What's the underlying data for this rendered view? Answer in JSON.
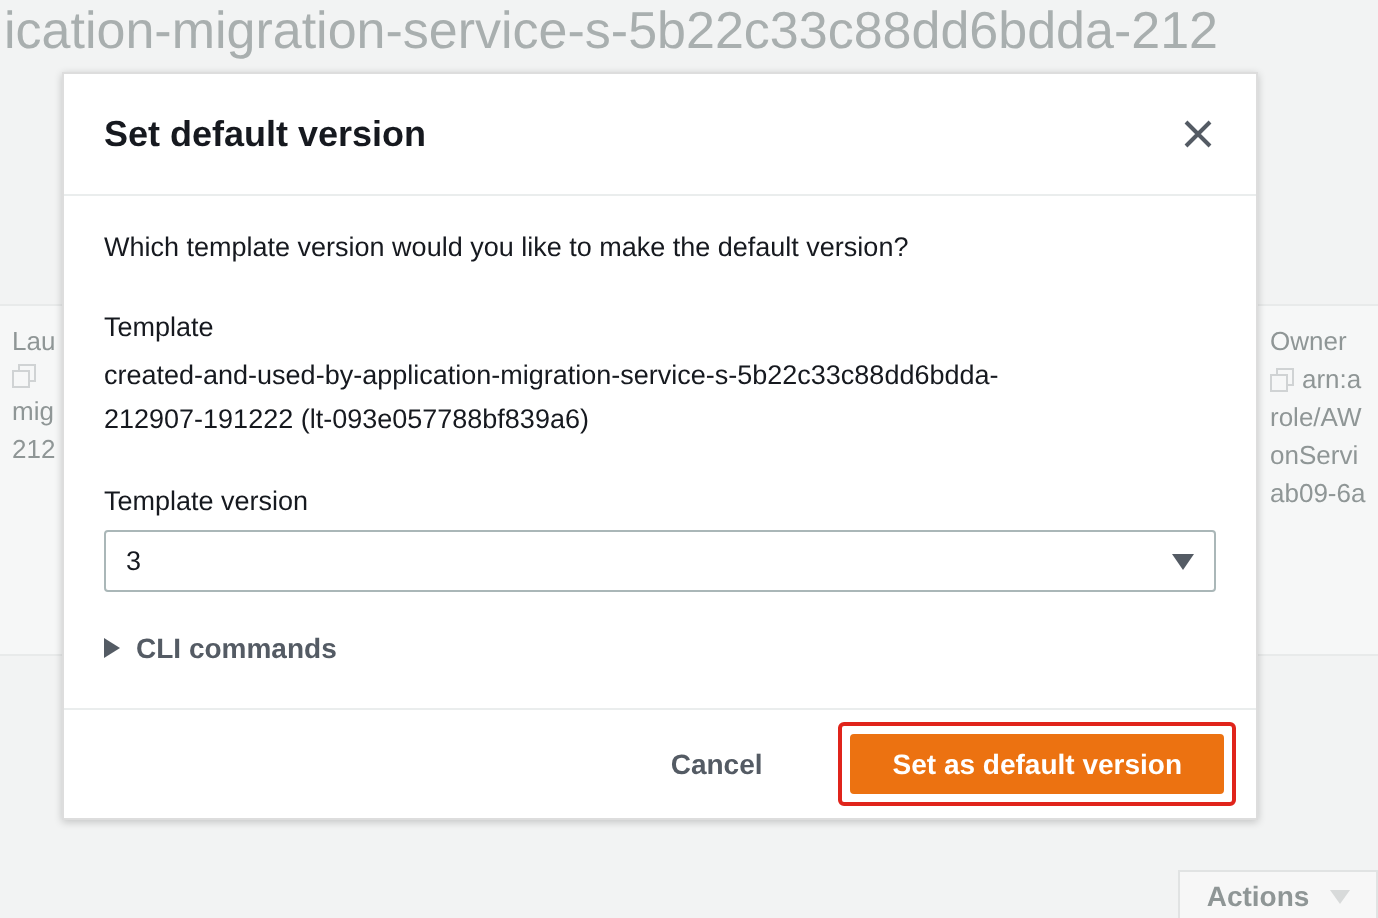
{
  "background": {
    "title": "ication-migration-service-s-5b22c33c88dd6bdda-212",
    "left_column": [
      "Lau",
      "mig",
      "212"
    ],
    "right_column": {
      "label": "Owner",
      "lines": [
        "arn:a",
        "role/AW",
        "onServi",
        "ab09-6a"
      ]
    },
    "actions_button": "Actions"
  },
  "dialog": {
    "title": "Set default version",
    "question": "Which template version would you like to make the default version?",
    "template_label": "Template",
    "template_value": "created-and-used-by-application-migration-service-s-5b22c33c88dd6bdda-212907-191222 (lt-093e057788bf839a6)",
    "version_label": "Template version",
    "version_value": "3",
    "cli": {
      "label": "CLI commands",
      "expanded": false
    },
    "cancel": "Cancel",
    "confirm": {
      "label": "Set as default version",
      "highlighted": true
    }
  }
}
